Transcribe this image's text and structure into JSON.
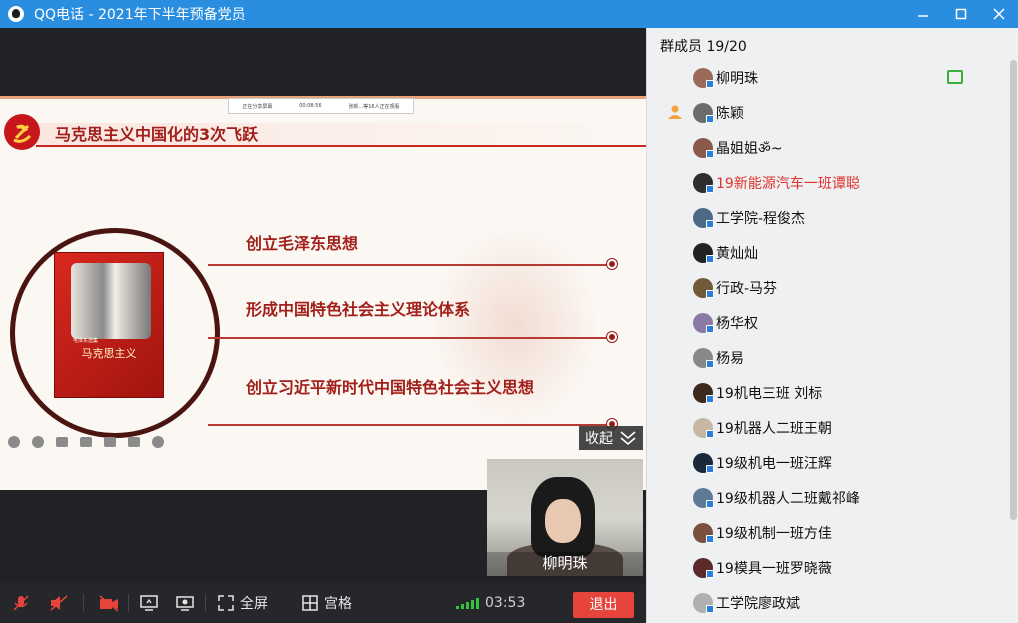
{
  "window": {
    "title": "QQ电话 - 2021年下半年预备党员"
  },
  "slide": {
    "share_bar": [
      "正在分享屏幕",
      "00:08:56",
      "张新...等16人正在观看"
    ],
    "title": "马克思主义中国化的3次飞跃",
    "book_small": "毛泽东选集",
    "book_title": "马克思主义",
    "items": [
      "创立毛泽东思想",
      "形成中国特色社会主义理论体系",
      "创立习近平新时代中国特色社会主义思想"
    ]
  },
  "collapse": {
    "label": "收起"
  },
  "selfcam": {
    "name": "柳明珠"
  },
  "toolbar": {
    "fullscreen_label": "全屏",
    "grid_label": "宫格",
    "timer": "03:53",
    "exit_label": "退出"
  },
  "panel": {
    "header": "群成员 19/20",
    "members": [
      {
        "name": "柳明珠",
        "red": false,
        "host": false,
        "sharing": true,
        "avatar_color": "#9a6b56"
      },
      {
        "name": "陈颖",
        "red": false,
        "host": true,
        "sharing": false,
        "avatar_color": "#6c6c6c"
      },
      {
        "name": "晶姐姐ॐ~",
        "red": false,
        "host": false,
        "sharing": false,
        "avatar_color": "#8a5a4a"
      },
      {
        "name": "19新能源汽车一班谭聪",
        "red": true,
        "host": false,
        "sharing": false,
        "avatar_color": "#2e2e2e"
      },
      {
        "name": "工学院-程俊杰",
        "red": false,
        "host": false,
        "sharing": false,
        "avatar_color": "#4c6a88"
      },
      {
        "name": "黄灿灿",
        "red": false,
        "host": false,
        "sharing": false,
        "avatar_color": "#222222"
      },
      {
        "name": "行政-马芬",
        "red": false,
        "host": false,
        "sharing": false,
        "avatar_color": "#6f5a3a"
      },
      {
        "name": "杨华权",
        "red": false,
        "host": false,
        "sharing": false,
        "avatar_color": "#8c7aa6"
      },
      {
        "name": "杨易",
        "red": false,
        "host": false,
        "sharing": false,
        "avatar_color": "#888888"
      },
      {
        "name": "19机电三班 刘标",
        "red": false,
        "host": false,
        "sharing": false,
        "avatar_color": "#3c2a1e"
      },
      {
        "name": "19机器人二班王朝",
        "red": false,
        "host": false,
        "sharing": false,
        "avatar_color": "#c7b8a4"
      },
      {
        "name": "19级机电一班汪辉",
        "red": false,
        "host": false,
        "sharing": false,
        "avatar_color": "#1b2a3a"
      },
      {
        "name": "19级机器人二班戴祁峰",
        "red": false,
        "host": false,
        "sharing": false,
        "avatar_color": "#5e7a96"
      },
      {
        "name": "19级机制一班方佳",
        "red": false,
        "host": false,
        "sharing": false,
        "avatar_color": "#7a5040"
      },
      {
        "name": "19模具一班罗晓薇",
        "red": false,
        "host": false,
        "sharing": false,
        "avatar_color": "#5a2a2a"
      },
      {
        "name": "工学院廖政斌",
        "red": false,
        "host": false,
        "sharing": false,
        "avatar_color": "#b0b0b0"
      }
    ]
  }
}
